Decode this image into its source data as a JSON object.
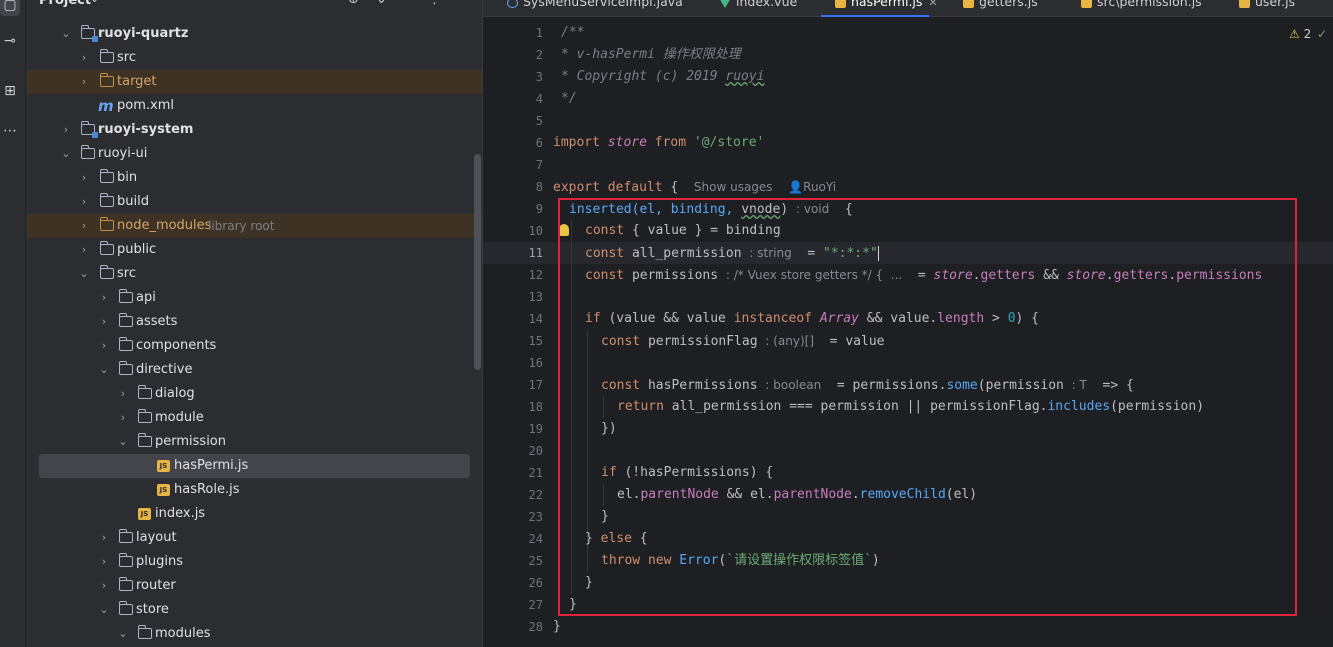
{
  "activity": {
    "icons": [
      "project-icon",
      "commit-icon",
      "structure-icon",
      "more-icon"
    ]
  },
  "project_panel": {
    "title": "Project",
    "tree": [
      {
        "label": "ruoyi-quartz",
        "type": "module",
        "expanded": true
      },
      {
        "label": "src",
        "type": "folder",
        "expanded": false
      },
      {
        "label": "target",
        "type": "folder-excluded",
        "expanded": false
      },
      {
        "label": "pom.xml",
        "type": "maven"
      },
      {
        "label": "ruoyi-system",
        "type": "module",
        "expanded": false
      },
      {
        "label": "ruoyi-ui",
        "type": "folder",
        "expanded": true
      },
      {
        "label": "bin",
        "type": "folder",
        "expanded": false
      },
      {
        "label": "build",
        "type": "folder",
        "expanded": false
      },
      {
        "label": "node_modules",
        "type": "folder-excluded",
        "expanded": false,
        "suffix": "library root"
      },
      {
        "label": "public",
        "type": "folder",
        "expanded": false
      },
      {
        "label": "src",
        "type": "folder",
        "expanded": true
      },
      {
        "label": "api",
        "type": "folder",
        "expanded": false
      },
      {
        "label": "assets",
        "type": "folder",
        "expanded": false
      },
      {
        "label": "components",
        "type": "folder",
        "expanded": false
      },
      {
        "label": "directive",
        "type": "folder",
        "expanded": true
      },
      {
        "label": "dialog",
        "type": "folder",
        "expanded": false
      },
      {
        "label": "module",
        "type": "folder",
        "expanded": false
      },
      {
        "label": "permission",
        "type": "folder",
        "expanded": true
      },
      {
        "label": "hasPermi.js",
        "type": "js",
        "selected": true
      },
      {
        "label": "hasRole.js",
        "type": "js"
      },
      {
        "label": "index.js",
        "type": "js"
      },
      {
        "label": "layout",
        "type": "folder",
        "expanded": false
      },
      {
        "label": "plugins",
        "type": "folder",
        "expanded": false
      },
      {
        "label": "router",
        "type": "folder",
        "expanded": false
      },
      {
        "label": "store",
        "type": "folder",
        "expanded": true
      },
      {
        "label": "modules",
        "type": "folder",
        "expanded": true
      }
    ]
  },
  "tabs": [
    {
      "label": "SysMenuServiceImpl.java",
      "icon": "java"
    },
    {
      "label": "index.vue",
      "icon": "vue"
    },
    {
      "label": "hasPermi.js",
      "icon": "js",
      "active": true
    },
    {
      "label": "getters.js",
      "icon": "js"
    },
    {
      "label": "src\\permission.js",
      "icon": "js"
    },
    {
      "label": "user.js",
      "icon": "js"
    }
  ],
  "inspections": {
    "warnings": "2"
  },
  "editor": {
    "line_numbers": [
      "1",
      "2",
      "3",
      "4",
      "5",
      "6",
      "7",
      "8",
      "9",
      "10",
      "11",
      "12",
      "13",
      "14",
      "15",
      "16",
      "17",
      "18",
      "19",
      "20",
      "21",
      "22",
      "23",
      "24",
      "25",
      "26",
      "27",
      "28"
    ],
    "current_line": "11",
    "lines": {
      "l1": "/**",
      "l2": "* v-hasPermi 操作权限处理",
      "l3a": "* Copyright (c) 2019 ",
      "l3b": "ruoyi",
      "l4": "*/",
      "l6a": "import ",
      "l6b": "store",
      "l6c": " from ",
      "l6d": "'@/store'",
      "l8a": "export default ",
      "l8b": "{",
      "l8hint1": "Show usages",
      "l8hint2": "RuoYi",
      "l9a": "inserted(el, binding, ",
      "l9b": "vnode",
      "l9c": ")",
      "l9hint": ": void",
      "l9d": "  {",
      "l10a": "const ",
      "l10b": "{ value } ",
      "l10c": "= binding",
      "l11a": "const ",
      "l11b": "all_permission",
      "l11hint": ": string",
      "l11c": "  = ",
      "l11d": "\"*:*:*\"",
      "l12a": "const ",
      "l12b": "permissions",
      "l12hint": ": /* Vuex store getters */ {  ...",
      "l12c": "  = ",
      "l12d": "store",
      "l12e": ".",
      "l12f": "getters",
      "l12g": " && ",
      "l12h": "store",
      "l12i": ".",
      "l12j": "getters",
      "l12k": ".",
      "l12l": "permissions",
      "l14a": "if ",
      "l14b": "(value && value ",
      "l14c": "instanceof ",
      "l14d": "Array",
      "l14e": " && value.",
      "l14f": "length",
      "l14g": " > ",
      "l14h": "0",
      "l14i": ") {",
      "l15a": "const ",
      "l15b": "permissionFlag",
      "l15hint": ": (any)[]",
      "l15c": "  = value",
      "l17a": "const ",
      "l17b": "hasPermissions",
      "l17hint": ": boolean",
      "l17c": "  = permissions.",
      "l17d": "some",
      "l17e": "(permission",
      "l17hint2": ": T",
      "l17f": "  => {",
      "l18a": "return ",
      "l18b": "all_permission === permission || permissionFlag.",
      "l18c": "includes",
      "l18d": "(permission)",
      "l19": "})",
      "l21a": "if ",
      "l21b": "(!hasPermissions) {",
      "l22a": "el.",
      "l22b": "parentNode",
      "l22c": " && el.",
      "l22d": "parentNode",
      "l22e": ".",
      "l22f": "removeChild",
      "l22g": "(el)",
      "l23": "}",
      "l24a": "} ",
      "l24b": "else ",
      "l24c": "{",
      "l25a": "throw new ",
      "l25b": "Error",
      "l25c": "(",
      "l25d": "`请设置操作权限标签值`",
      "l25e": ")",
      "l26": "}",
      "l27": "}",
      "l28": "}"
    }
  },
  "colors": {
    "keyword": "#cf8e6d",
    "string": "#6aab73",
    "comment": "#7a7e85",
    "function": "#56a8f5",
    "property": "#c77dbb",
    "number": "#2aacb8",
    "highlight_box": "#e0243a"
  }
}
